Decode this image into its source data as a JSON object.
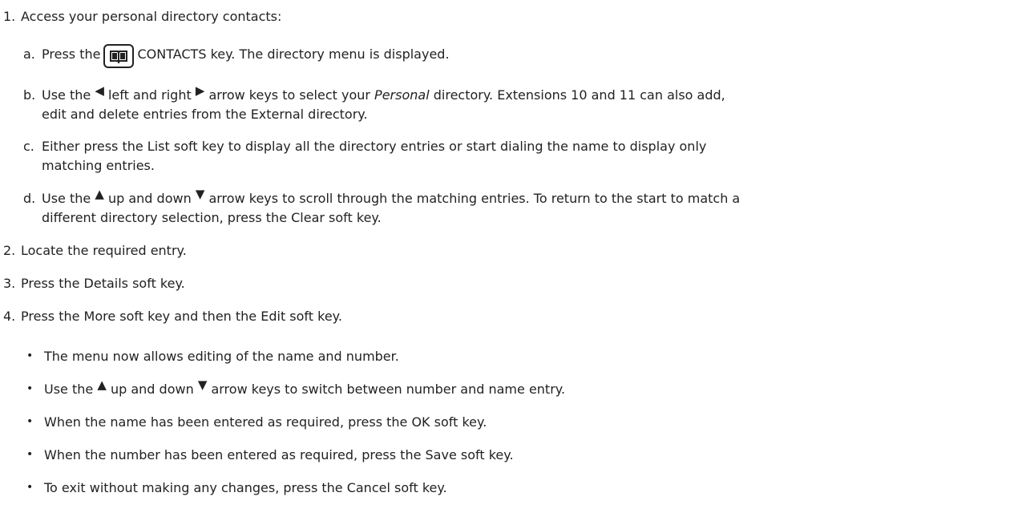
{
  "steps": {
    "s1": {
      "num": "1.",
      "text": "Access your personal directory contacts:"
    },
    "a": {
      "marker": "a.",
      "t1": "Press the",
      "t2": "CONTACTS key. The directory menu is displayed.",
      "icon": "contacts-book-icon"
    },
    "b": {
      "marker": "b.",
      "t1": "Use the",
      "left_glyph": "◀",
      "t2": "left and right",
      "right_glyph": "▶",
      "t3": "arrow keys to select your",
      "t4": "Personal",
      "t5": "directory. Extensions 10 and 11 can also add,",
      "line2": "edit and delete entries from the External directory."
    },
    "c": {
      "marker": "c.",
      "line1": "Either press the List soft key to display all the directory entries or start dialing the name to display only",
      "line2": "matching entries."
    },
    "d": {
      "marker": "d.",
      "t1": "Use the",
      "up_glyph": "▲",
      "t2": "up and down",
      "down_glyph": "▼",
      "t3": "arrow keys to scroll through the matching entries. To return to the start to match a",
      "line2": "different directory selection, press the Clear soft key."
    },
    "s2": {
      "num": "2.",
      "text": "Locate the required entry."
    },
    "s3": {
      "num": "3.",
      "text": "Press the Details soft key."
    },
    "s4": {
      "num": "4.",
      "text": "Press the More soft key and then the Edit soft key."
    },
    "bullets": {
      "b1": "The menu now allows editing of the name and number.",
      "b2_t1": "Use the",
      "b2_up": "▲",
      "b2_t2": "up and down",
      "b2_down": "▼",
      "b2_t3": "arrow keys to switch between number and name entry.",
      "b3": "When the name has been entered as required, press the OK soft key.",
      "b4": "When the number has been entered as required, press the Save soft key.",
      "b5": "To exit without making any changes, press the Cancel soft key.",
      "symbol": "•"
    }
  }
}
